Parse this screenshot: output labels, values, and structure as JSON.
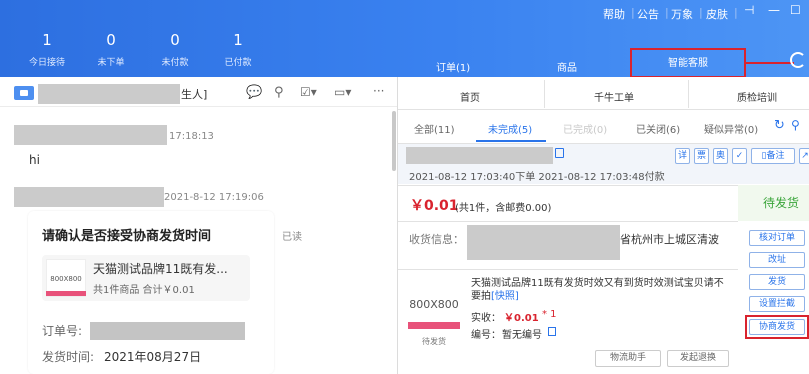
{
  "topbar": {
    "menu": [
      "帮助",
      "公告",
      "万象",
      "皮肤"
    ],
    "window_controls": [
      "pin-icon",
      "minimize-icon",
      "maximize-icon"
    ],
    "stats": [
      {
        "value": "1",
        "label": "今日接待"
      },
      {
        "value": "0",
        "label": "未下单"
      },
      {
        "value": "0",
        "label": "未付款"
      },
      {
        "value": "1",
        "label": "已付款"
      }
    ],
    "tabs": [
      "订单(1)",
      "商品",
      "智能客服"
    ]
  },
  "chat": {
    "header_suffix": "生人]",
    "msg1_time": "17:18:13",
    "msg1_text": "hi",
    "msg2_time": "2021-8-12 17:19:06",
    "read_status": "已读",
    "card_title": "请确认是否接受协商发货时间",
    "card_thumb": "800X800",
    "card_product": "天猫测试品牌11既有发...",
    "card_summary": "共1件商品  合计￥0.01",
    "order_label": "订单号:",
    "ship_label": "发货时间:",
    "ship_date": "2021年08月27日"
  },
  "right": {
    "nav": [
      "首页",
      "千牛工单",
      "质检培训"
    ],
    "subtabs": [
      "全部(11)",
      "未完成(5)",
      "已完成(0)",
      "已关闭(6)",
      "疑似异常(0)"
    ],
    "order_icons": [
      "详",
      "票",
      "奥"
    ],
    "note_button": "备注",
    "order_times": "2021-08-12 17:03:40下单  2021-08-12 17:03:48付款",
    "price": "￥0.01",
    "price_note": "(共1件，含邮费0.00)",
    "status": "待发货",
    "address_label": "收货信息：",
    "address_partial": "省杭州市上城区清波",
    "actions": [
      "核对订单",
      "改址",
      "发货",
      "设置拦截",
      "协商发货"
    ],
    "product_thumb": "800X800",
    "product_thumb_caption": "待发货",
    "product_name": "天猫测试品牌11既有发货时效又有到货时效测试宝贝请不要拍",
    "product_tag": "[快照]",
    "paid_label": "实收：",
    "paid_value": "￥0.01",
    "qty": "* 1",
    "code_label": "编号：",
    "code_value": "暂无编号",
    "bottom_buttons": [
      "物流助手",
      "发起退换"
    ]
  },
  "colors": {
    "accent": "#2a74ea",
    "price_red": "#d9232e",
    "status_green": "#3aa53a",
    "highlight_box": "#d9232e"
  }
}
